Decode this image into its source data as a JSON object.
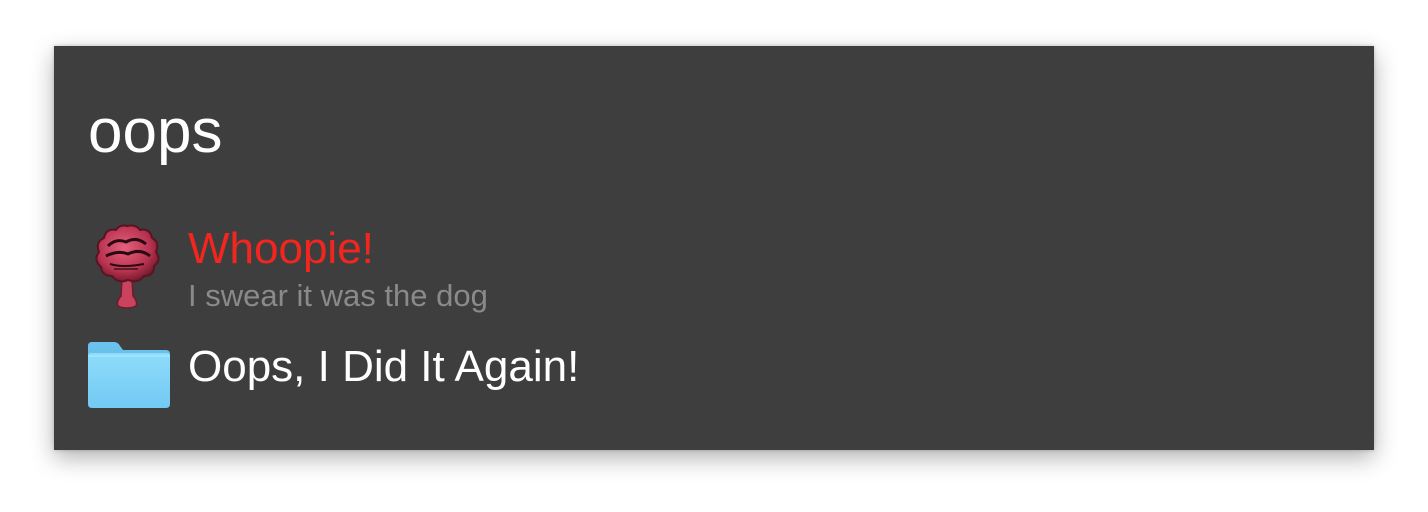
{
  "search": {
    "query": "oops"
  },
  "results": [
    {
      "title": "Whoopie!",
      "subtitle": "I swear it was the dog",
      "icon": "whoopee-cushion-icon",
      "title_color": "#f3261f"
    },
    {
      "title": "Oops, I Did It Again!",
      "icon": "folder-icon",
      "title_color": "#ffffff"
    }
  ],
  "colors": {
    "panel_background": "#3e3e3e",
    "query_text": "#ffffff",
    "subtitle_text": "#8a8a8a",
    "folder_blue": "#7fd2f8"
  }
}
